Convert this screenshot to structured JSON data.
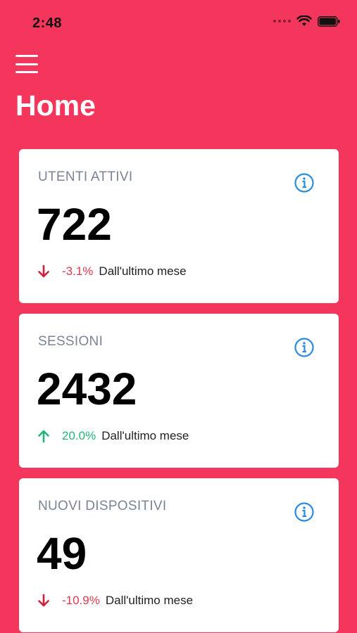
{
  "status_bar": {
    "time": "2:48"
  },
  "header": {
    "title": "Home"
  },
  "colors": {
    "background": "#f4365c",
    "card": "#ffffff",
    "info": "#2b8be0",
    "down": "#d0203a",
    "up": "#22b573",
    "label": "#7a8496"
  },
  "cards": [
    {
      "label": "UTENTI ATTIVI",
      "value": "722",
      "trend": "down",
      "percent": "-3.1%",
      "comparison": "Dall'ultimo mese",
      "info_icon": "info-icon"
    },
    {
      "label": "SESSIONI",
      "value": "2432",
      "trend": "up",
      "percent": "20.0%",
      "comparison": "Dall'ultimo mese",
      "info_icon": "info-icon"
    },
    {
      "label": "NUOVI DISPOSITIVI",
      "value": "49",
      "trend": "down",
      "percent": "-10.9%",
      "comparison": "Dall'ultimo mese",
      "info_icon": "info-icon"
    }
  ]
}
